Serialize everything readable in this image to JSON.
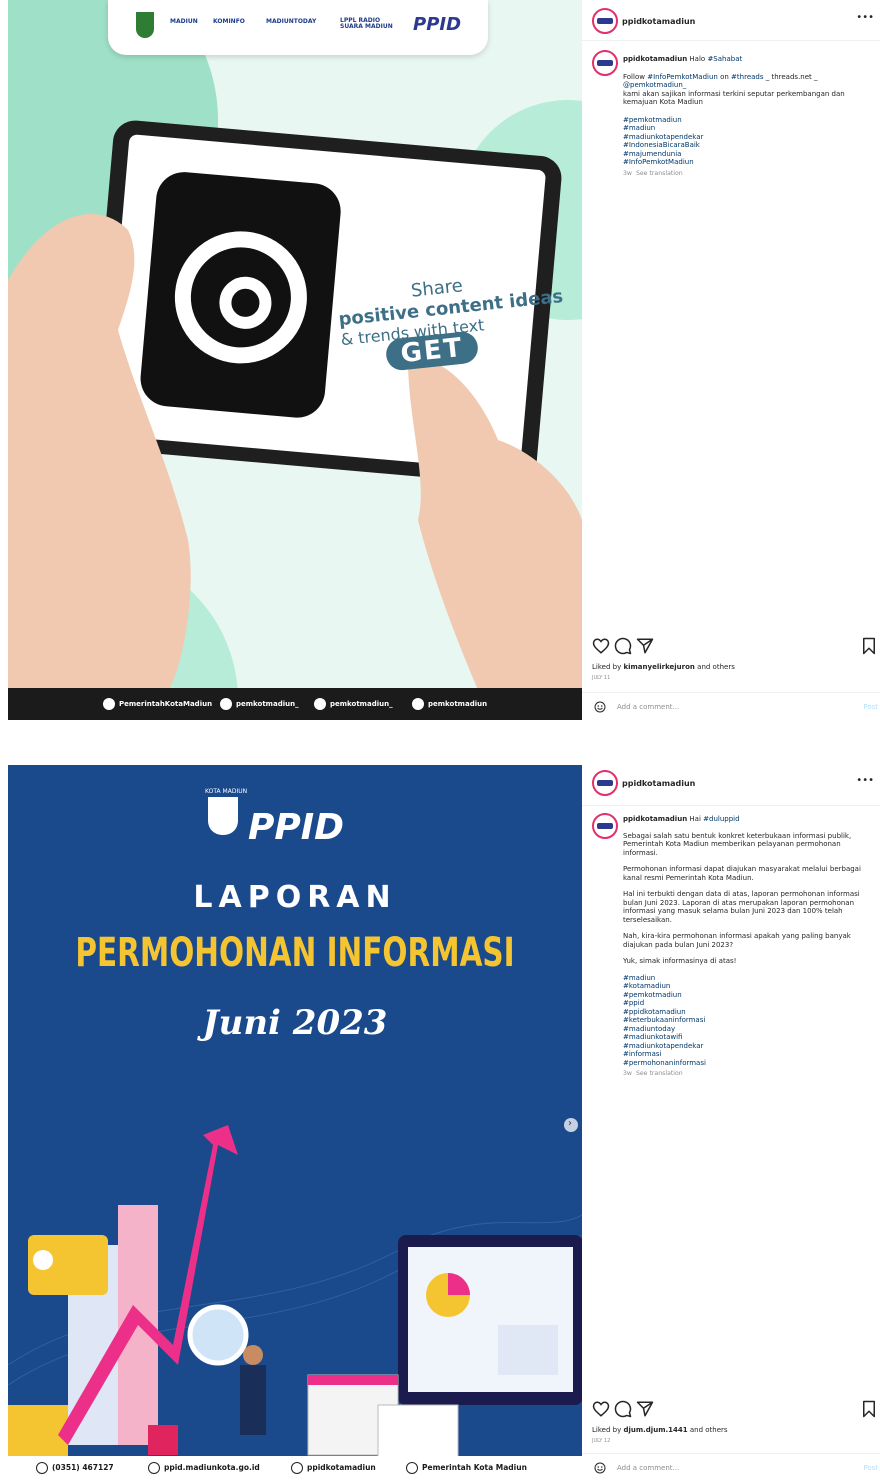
{
  "post1": {
    "account": "ppidkotamadiun",
    "caption_user": "ppidkotamadiun",
    "caption_first": "Halo",
    "caption_first_tag": "#Sahabat",
    "follow_pre": "Follow",
    "follow_tag1": "#InfoPemkotMadiun",
    "follow_mid": "on",
    "follow_tag2": "#threads",
    "follow_post": "_ threads.net _",
    "follow_handle": "@pemkotmadiun_",
    "body": "kami akan sajikan informasi terkini seputar perkembangan dan kemajuan Kota Madiun",
    "hashtags": [
      "#pemkotmadiun",
      "#madiun",
      "#madiunkotapendekar",
      "#IndonesiaBicaraBaik",
      "#majumendunia",
      "#InfoPemkotMadiun"
    ],
    "time": "3w",
    "see_translation": "See translation",
    "liked_prefix": "Liked by",
    "liked_user": "kimanyelirkejuron",
    "liked_suffix": "and others",
    "date": "JULY 11",
    "comment_placeholder": "Add a comment...",
    "post_button": "Post",
    "art": {
      "logos": [
        "MADIUN",
        "KOMINFO",
        "MADIUNTODAY",
        "LPPL RADIO SUARA MADIUN",
        "PPID"
      ],
      "share_line1": "Share",
      "share_line2": "positive content ideas",
      "share_line3": "& trends with text",
      "get": "GET",
      "footer": [
        "PemerintahKotaMadiun",
        "pemkotmadiun_",
        "pemkotmadiun_",
        "pemkotmadiun"
      ]
    }
  },
  "post2": {
    "account": "ppidkotamadiun",
    "caption_user": "ppidkotamadiun",
    "caption_first": "Hai",
    "caption_first_tag": "#duluppid",
    "paragraphs": [
      "Sebagai salah satu bentuk konkret keterbukaan informasi publik, Pemerintah Kota Madiun memberikan pelayanan permohonan informasi.",
      "Permohonan informasi dapat diajukan masyarakat melalui berbagai kanal resmi Pemerintah Kota Madiun.",
      "Hal ini terbukti dengan data di atas, laporan permohonan informasi bulan Juni 2023. Laporan di atas merupakan laporan permohonan informasi yang masuk selama bulan Juni 2023 dan 100% telah terselesaikan.",
      "Nah, kira-kira permohonan informasi apakah yang paling banyak diajukan pada bulan Juni 2023?",
      "Yuk, simak informasinya di atas!"
    ],
    "hashtags": [
      "#madiun",
      "#kotamadiun",
      "#pemkotmadiun",
      "#ppid",
      "#ppidkotamadiun",
      "#keterbukaaninformasi",
      "#madiuntoday",
      "#madiunkotawifi",
      "#madiunkotapendekar",
      "#informasi",
      "#permohonaninformasi"
    ],
    "time": "3w",
    "see_translation": "See translation",
    "liked_prefix": "Liked by",
    "liked_user": "djum.djum.1441",
    "liked_suffix": "and others",
    "date": "JULY 12",
    "comment_placeholder": "Add a comment...",
    "post_button": "Post",
    "art": {
      "kota": "KOTA MADIUN",
      "brand": "PPID",
      "title1": "LAPORAN",
      "title2": "PERMOHONAN INFORMASI",
      "title3": "Juni 2023",
      "footer": [
        "(0351) 467127",
        "ppid.madiunkota.go.id",
        "ppidkotamadiun",
        "Pemerintah Kota Madiun"
      ]
    }
  },
  "icons": {
    "like": "heart-icon",
    "comment": "comment-icon",
    "share": "share-icon",
    "save": "bookmark-icon",
    "more": "more-options-icon",
    "emoji": "emoji-icon",
    "next": "chevron-right-icon"
  },
  "colors": {
    "link": "#00376b",
    "muted": "#8e8e8e",
    "post1_bg": "#d9f3ea",
    "post2_bg": "#1b4a8c",
    "accent_yellow": "#f5c431"
  }
}
